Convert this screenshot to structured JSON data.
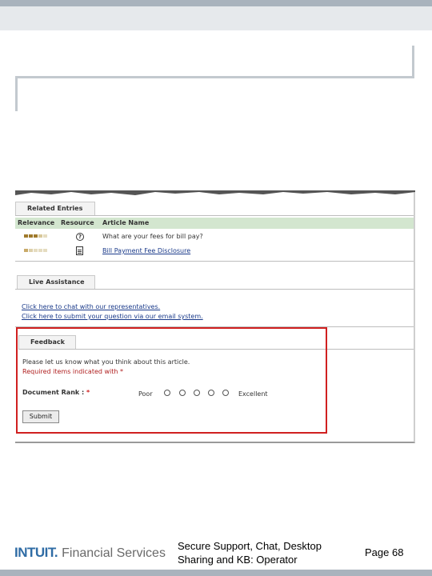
{
  "related": {
    "tab_label": "Related Entries",
    "columns": [
      "Relevance",
      "Resource",
      "Article Name"
    ],
    "rows": [
      {
        "article": "What are your fees for bill pay?",
        "icon": "question-icon",
        "is_link": false
      },
      {
        "article": "Bill Payment Fee Disclosure",
        "icon": "document-icon",
        "is_link": true
      }
    ]
  },
  "live_assistance": {
    "tab_label": "Live Assistance",
    "links": [
      "Click here to chat with our representatives.",
      "Click here to submit your question via our email system."
    ]
  },
  "feedback": {
    "tab_label": "Feedback",
    "intro": "Please let us know what you think about this article.",
    "required_note": "Required items indicated with *",
    "rank_label": "Document Rank : ",
    "required_mark": "*",
    "scale_low": "Poor",
    "scale_high": "Excellent",
    "submit_label": "Submit"
  },
  "footer": {
    "logo_brand": "INTUIT.",
    "logo_suffix": "Financial Services",
    "title": "Secure Support, Chat, Desktop Sharing and KB: Operator",
    "page": "Page 68"
  },
  "colors": {
    "frame": "#a9b3bd",
    "accent_red": "#d02020",
    "link_blue": "#1a3a8a",
    "header_green": "#d3e6cf",
    "brand_blue": "#2f6ca5"
  }
}
